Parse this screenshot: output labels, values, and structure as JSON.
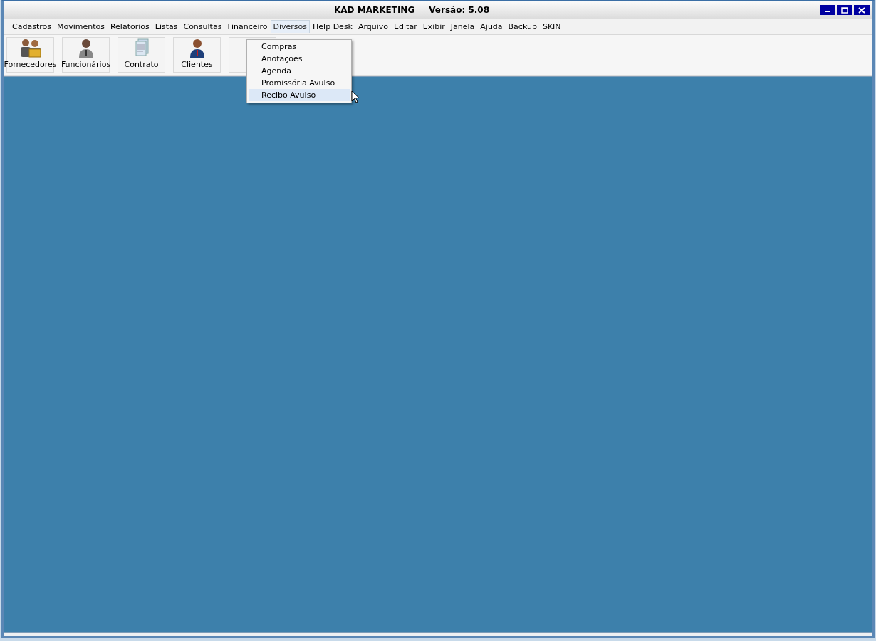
{
  "window": {
    "title": "KAD MARKETING",
    "version": "Versão: 5.08"
  },
  "menu_bar": [
    {
      "label": "Cadastros",
      "selected": false
    },
    {
      "label": "Movimentos",
      "selected": false
    },
    {
      "label": "Relatorios",
      "selected": false
    },
    {
      "label": "Listas",
      "selected": false
    },
    {
      "label": "Consultas",
      "selected": false
    },
    {
      "label": "Financeiro",
      "selected": false
    },
    {
      "label": "Diversos",
      "selected": true
    },
    {
      "label": "Help Desk",
      "selected": false
    },
    {
      "label": "Arquivo",
      "selected": false
    },
    {
      "label": "Editar",
      "selected": false
    },
    {
      "label": "Exibir",
      "selected": false
    },
    {
      "label": "Janela",
      "selected": false
    },
    {
      "label": "Ajuda",
      "selected": false
    },
    {
      "label": "Backup",
      "selected": false
    },
    {
      "label": "SKIN",
      "selected": false
    }
  ],
  "toolbar": [
    {
      "label": "Fornecedores",
      "kind": "group"
    },
    {
      "label": "Funcionários",
      "kind": "person"
    },
    {
      "label": "Contrato",
      "kind": "document"
    },
    {
      "label": "Clientes",
      "kind": "client"
    },
    {
      "kind": "blank"
    }
  ],
  "dropdown": [
    {
      "label": "Compras",
      "selected": false
    },
    {
      "label": "Anotações",
      "selected": false
    },
    {
      "label": "Agenda",
      "selected": false
    },
    {
      "label": "Promissória Avulso",
      "selected": false
    },
    {
      "label": "Recibo Avulso",
      "selected": true
    }
  ]
}
